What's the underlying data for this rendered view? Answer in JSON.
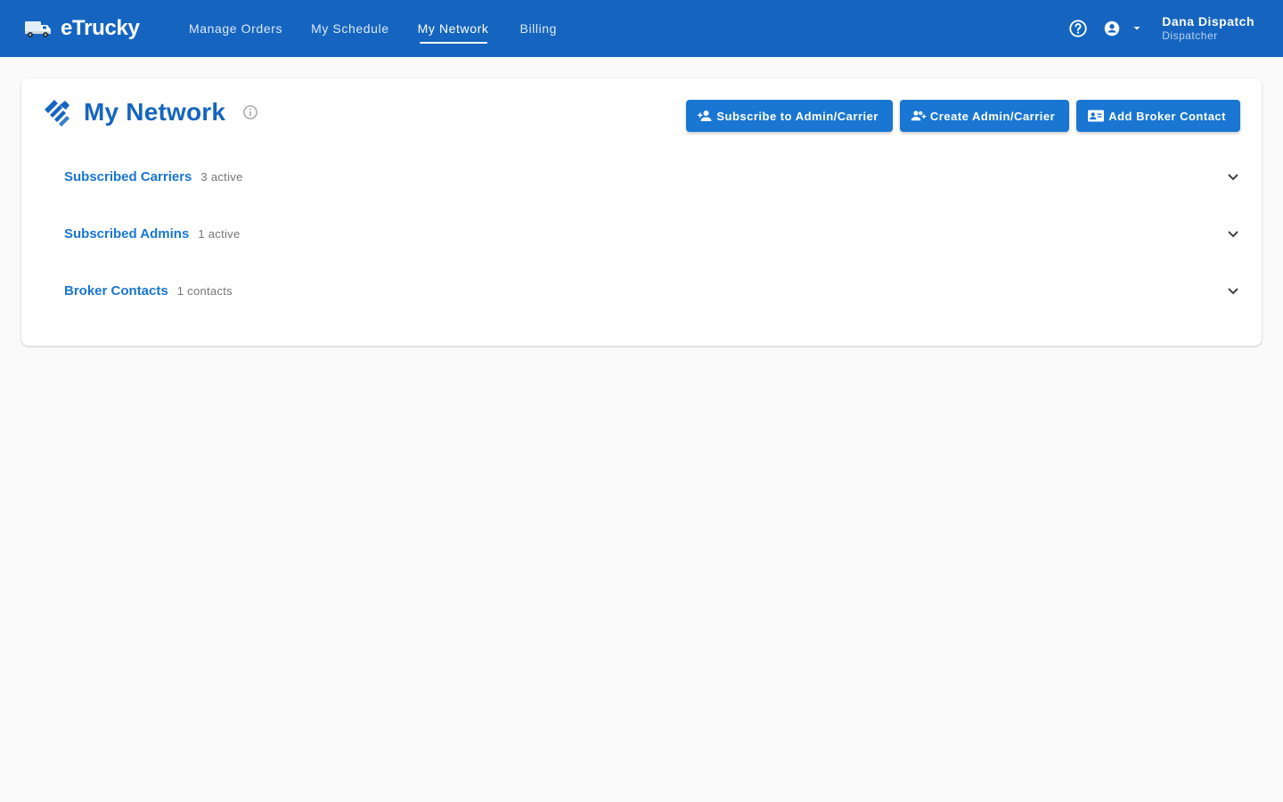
{
  "app": {
    "brand": "eTrucky"
  },
  "nav": {
    "items": [
      {
        "label": "Manage Orders",
        "active": false
      },
      {
        "label": "My Schedule",
        "active": false
      },
      {
        "label": "My Network",
        "active": true
      },
      {
        "label": "Billing",
        "active": false
      }
    ]
  },
  "user": {
    "name": "Dana Dispatch",
    "role": "Dispatcher"
  },
  "page": {
    "title": "My Network",
    "actions": {
      "subscribe": "Subscribe to Admin/Carrier",
      "create": "Create Admin/Carrier",
      "add_broker": "Add Broker Contact"
    }
  },
  "sections": [
    {
      "title": "Subscribed Carriers",
      "count": "3 active"
    },
    {
      "title": "Subscribed Admins",
      "count": "1 active"
    },
    {
      "title": "Broker Contacts",
      "count": "1 contacts"
    }
  ],
  "colors": {
    "primary": "#1565c0",
    "button": "#1976d2",
    "background": "#fafafa"
  }
}
